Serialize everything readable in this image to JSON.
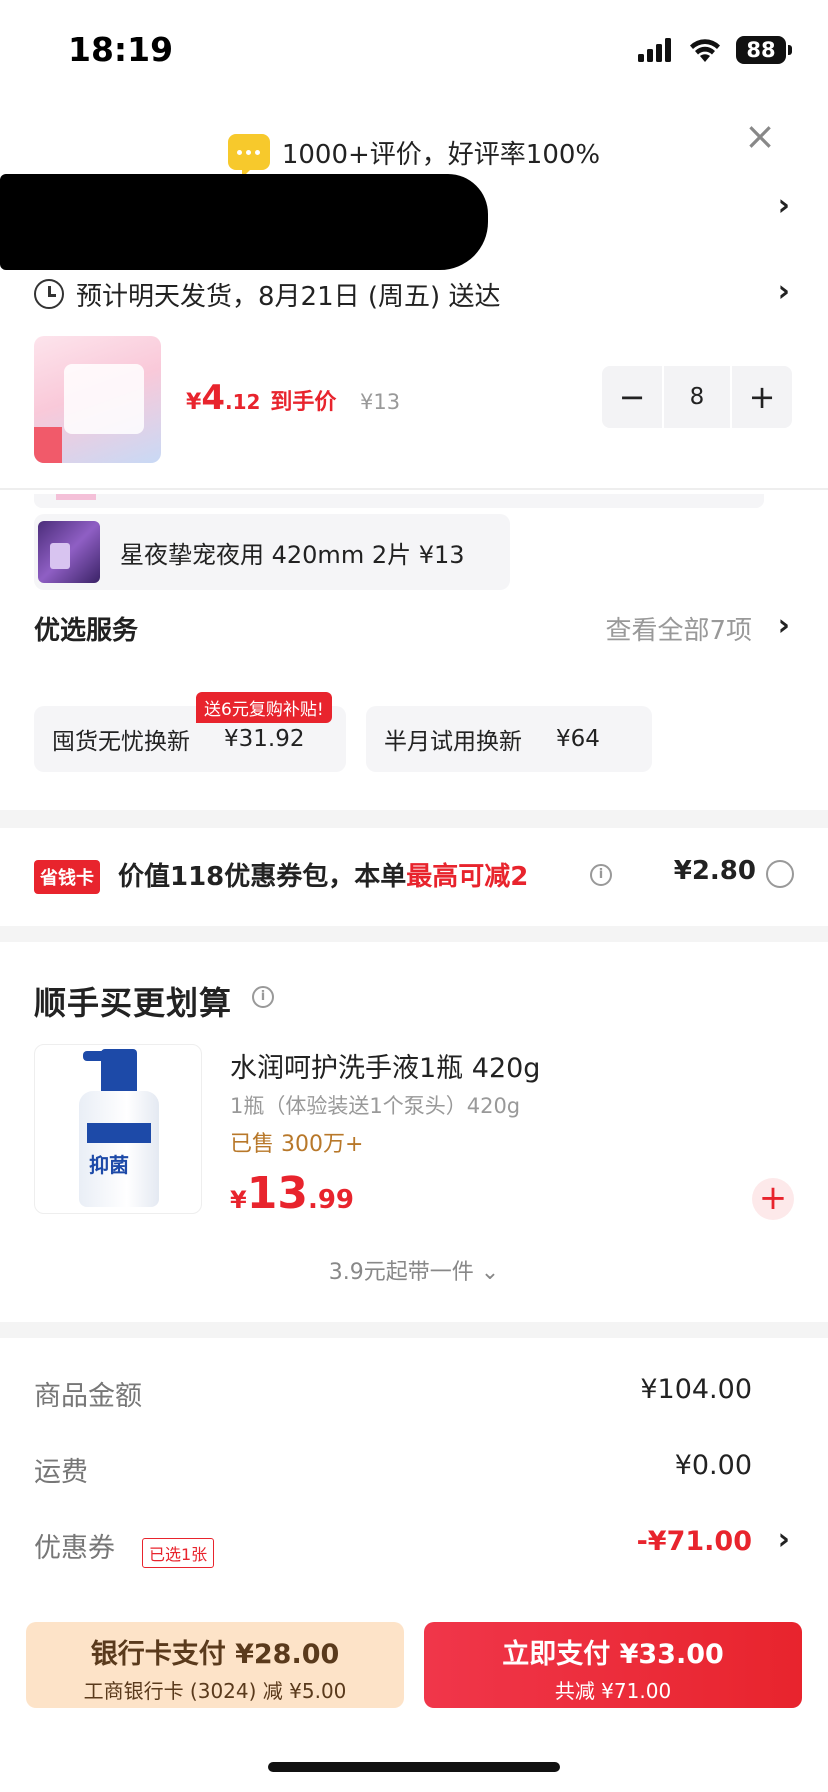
{
  "status_bar": {
    "time": "18:19",
    "battery": "88"
  },
  "review_banner": {
    "text": "1000+评价，好评率100%"
  },
  "delivery": {
    "text": "预计明天发货，8月21日 (周五) 送达"
  },
  "product": {
    "price_currency": "¥",
    "price_int": "4",
    "price_dec": ".12",
    "price_label": "到手价",
    "original_price": "¥13",
    "quantity": "8"
  },
  "gift": {
    "text": "星夜挚宠夜用 420mm 2片  ¥13"
  },
  "services": {
    "title": "优选服务",
    "view_all": "查看全部7项",
    "items": [
      {
        "name": "囤货无忧换新",
        "price": "¥31.92",
        "badge": "送6元复购补贴!"
      },
      {
        "name": "半月试用换新",
        "price": "¥64"
      }
    ]
  },
  "coupon_pack": {
    "badge": "省钱卡",
    "text_prefix": "价值118优惠券包，本单",
    "text_highlight": "最高可减2",
    "amount": "¥2.80"
  },
  "cross_sell": {
    "title": "顺手买更划算",
    "title_plus": "+",
    "product_name": "水润呵护洗手液1瓶 420g",
    "spec": "1瓶（体验装送1个泵头）420g",
    "sold": "已售 300万+",
    "price_currency": "¥",
    "price_int": "13",
    "price_dec": ".99",
    "bottle_label": "抑菌",
    "more": "3.9元起带一件"
  },
  "summary": {
    "items_label": "商品金额",
    "items_value": "¥104.00",
    "shipping_label": "运费",
    "shipping_value": "¥0.00",
    "coupon_label": "优惠券",
    "coupon_tag": "已选1张",
    "coupon_value": "-¥71.00"
  },
  "bottom_bar": {
    "bank_pay_line1": "银行卡支付 ¥28.00",
    "bank_pay_line2": "工商银行卡 (3024) 减 ¥5.00",
    "pay_now_line1": "立即支付 ¥33.00",
    "pay_now_line2": "共减 ¥71.00"
  },
  "colors": {
    "accent_red": "#e8242d",
    "bank_bg": "#fde3c8"
  }
}
